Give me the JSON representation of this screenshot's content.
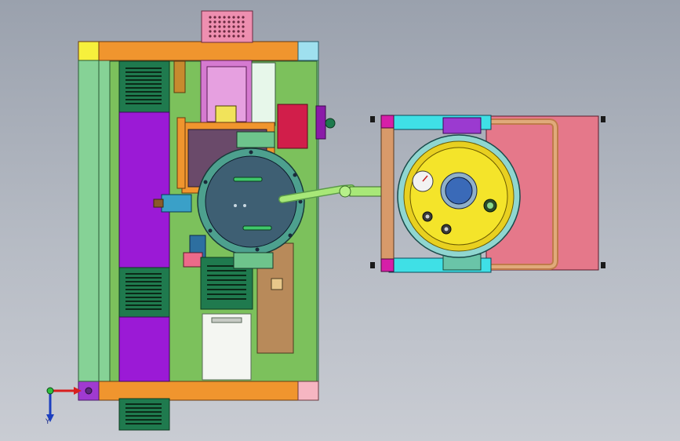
{
  "view": {
    "background_top": "#9aa1ad",
    "background_bottom": "#c9ccd3"
  },
  "model": {
    "frame_color": "#86d296",
    "rail_color": "#f0952e",
    "plate_color": "#7cc15c",
    "purple_color": "#9b1ad6",
    "vent_color": "#1f7a4e",
    "pink_color": "#e5788a",
    "tank_yellow": "#f4e42a",
    "tank_blue": "#3a6ab8",
    "turntable_color": "#3e5f73",
    "pipe_color": "#a8e878",
    "tube_color": "#d89a6a",
    "cyan_color": "#3fe0e6",
    "magenta_color": "#d61fa8"
  },
  "triad": {
    "y_label": "Y",
    "x_color": "#d81e1e",
    "y_color": "#1c3fbf",
    "z_color": "#2fbf3f"
  }
}
